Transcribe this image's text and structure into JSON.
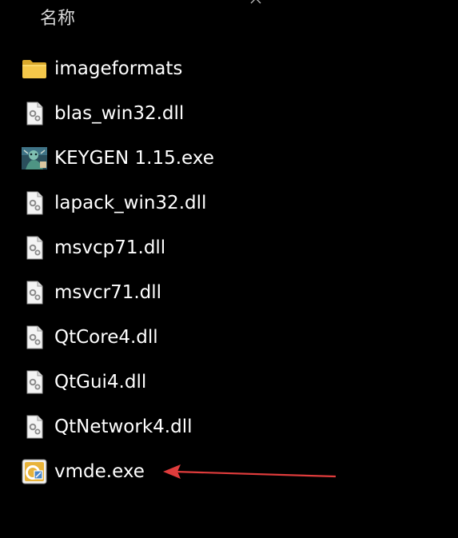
{
  "header": {
    "column_name": "名称",
    "sort_icon": "chevron-up-icon"
  },
  "files": [
    {
      "name": "imageformats",
      "type": "folder",
      "icon": "folder-icon"
    },
    {
      "name": "blas_win32.dll",
      "type": "dll",
      "icon": "dll-file-icon"
    },
    {
      "name": "KEYGEN 1.15.exe",
      "type": "exe",
      "icon": "keygen-app-icon"
    },
    {
      "name": "lapack_win32.dll",
      "type": "dll",
      "icon": "dll-file-icon"
    },
    {
      "name": "msvcp71.dll",
      "type": "dll",
      "icon": "dll-file-icon"
    },
    {
      "name": "msvcr71.dll",
      "type": "dll",
      "icon": "dll-file-icon"
    },
    {
      "name": "QtCore4.dll",
      "type": "dll",
      "icon": "dll-file-icon"
    },
    {
      "name": "QtGui4.dll",
      "type": "dll",
      "icon": "dll-file-icon"
    },
    {
      "name": "QtNetwork4.dll",
      "type": "dll",
      "icon": "dll-file-icon"
    },
    {
      "name": "vmde.exe",
      "type": "exe",
      "icon": "vmde-app-icon"
    }
  ],
  "annotation": {
    "arrow_color": "#e03c3c",
    "points_to": "vmde.exe"
  }
}
